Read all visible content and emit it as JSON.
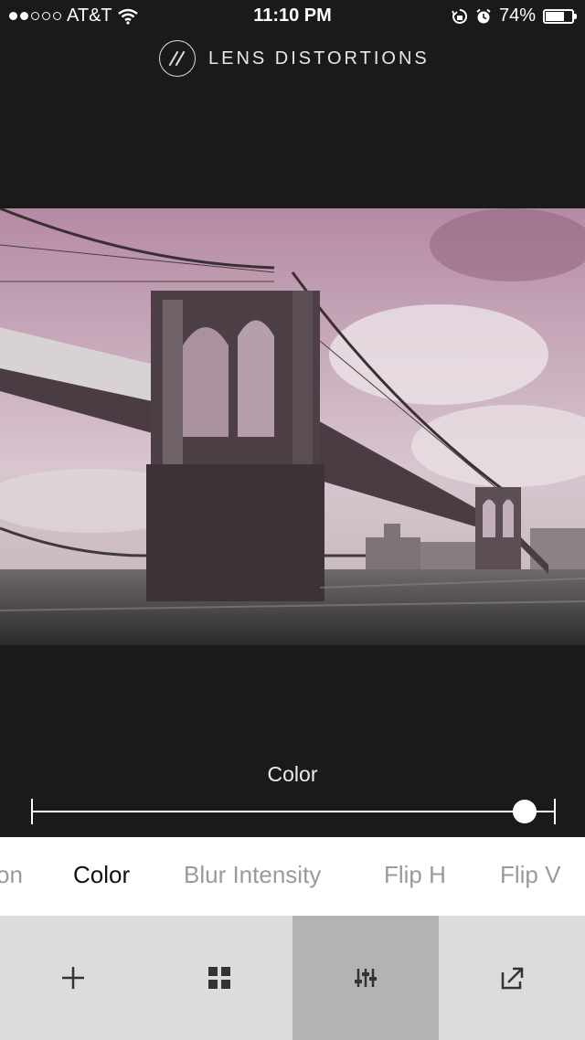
{
  "status_bar": {
    "signal_filled": 2,
    "signal_total": 5,
    "carrier": "AT&T",
    "time": "11:10 PM",
    "battery": "74%",
    "battery_level": 0.74,
    "icons": [
      "wifi-icon",
      "rotation-lock-icon",
      "alarm-icon",
      "battery-icon"
    ]
  },
  "header": {
    "app_title": "LENS DISTORTIONS"
  },
  "editor": {
    "parameter_label": "Color",
    "slider_value": 0.94
  },
  "tabs": [
    {
      "label": "on",
      "active": false
    },
    {
      "label": "Color",
      "active": true
    },
    {
      "label": "Blur Intensity",
      "active": false
    },
    {
      "label": "Flip H",
      "active": false
    },
    {
      "label": "Flip V",
      "active": false
    }
  ],
  "toolbar": {
    "items": [
      {
        "icon": "plus-icon",
        "active": false
      },
      {
        "icon": "grid-icon",
        "active": false
      },
      {
        "icon": "sliders-icon",
        "active": true
      },
      {
        "icon": "share-icon",
        "active": false
      }
    ]
  },
  "colors": {
    "background": "#1a1a1b",
    "tab_bar": "#ffffff",
    "toolbar": "#dcdcdc",
    "toolbar_active": "#b3b3b3",
    "photo_tint": "#9a6d86"
  }
}
